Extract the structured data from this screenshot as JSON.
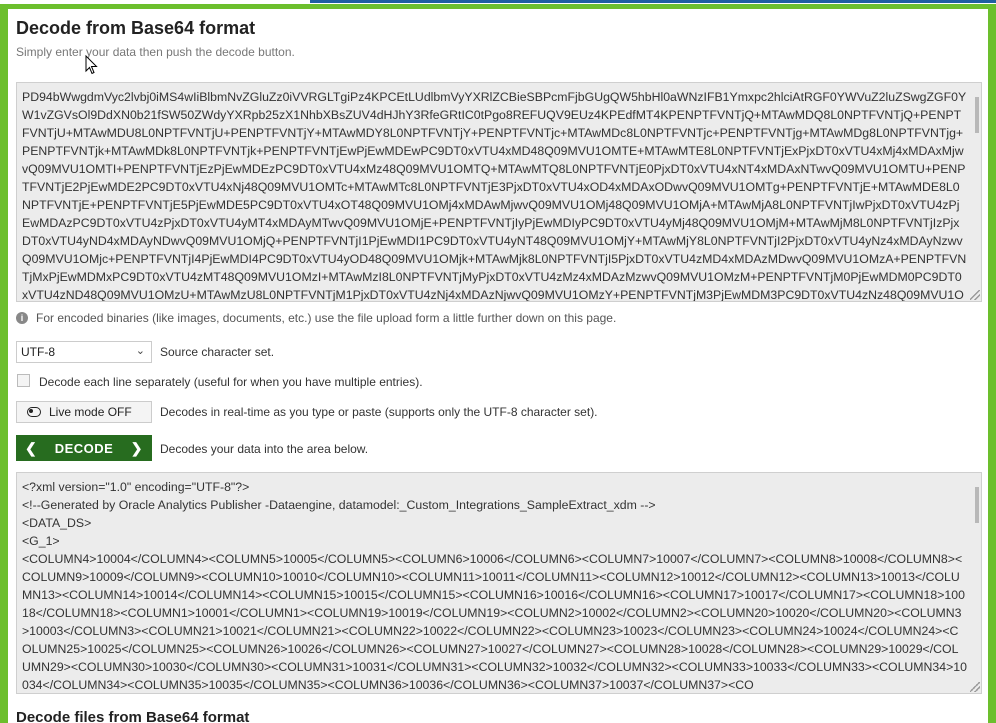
{
  "header": {
    "title": "Decode from Base64 format",
    "subtitle": "Simply enter your data then push the decode button."
  },
  "input_area": {
    "value": "PD94bWwgdmVyc2lvbj0iMS4wIiBlbmNvZGluZz0iVVRGLTgiPz4KPCEtLUdlbmVyYXRlZCBieSBPcmFjbGUgQW5hbHl0aWNzIFB1Ymxpc2hlciAtRGF0YWVuZ2luZSwgZGF0YW1vZGVsOl9DdXN0b21fSW50ZWdyYXRpb25zX1NhbXBsZUV4dHJhY3RfeGRtIC0tPgo8REFUQV9EUz4KPEdfMT4KPENPTFVNTjQ+MTAwMDQ8L0NPTFVNTjQ+PENPTFVNTjU+MTAwMDU8L0NPTFVNTjU+PENPTFVNTjY+MTAwMDY8L0NPTFVNTjY+PENPTFVNTjc+MTAwMDc8L0NPTFVNTjc+PENPTFVNTjg+MTAwMDg8L0NPTFVNTjg+PENPTFVNTjk+MTAwMDk8L0NPTFVNTjk+PENPTFVNTjEwPjEwMDEwPC9DT0xVTU4xMD48Q09MVU1OMTE+MTAwMTE8L0NPTFVNTjExPjxDT0xVTU4xMj4xMDAxMjwvQ09MVU1OMTI+PENPTFVNTjEzPjEwMDEzPC9DT0xVTU4xMz48Q09MVU1OMTQ+MTAwMTQ8L0NPTFVNTjE0PjxDT0xVTU4xNT4xMDAxNTwvQ09MVU1OMTU+PENPTFVNTjE2PjEwMDE2PC9DT0xVTU4xNj48Q09MVU1OMTc+MTAwMTc8L0NPTFVNTjE3PjxDT0xVTU4xOD4xMDAxODwvQ09MVU1OMTg+PENPTFVNTjE+MTAwMDE8L0NPTFVNTjE+PENPTFVNTjE5PjEwMDE5PC9DT0xVTU4xOT48Q09MVU1OMj4xMDAwMjwvQ09MVU1OMj48Q09MVU1OMjA+MTAwMjA8L0NPTFVNTjIwPjxDT0xVTU4zPjEwMDAzPC9DT0xVTU4zPjxDT0xVTU4yMT4xMDAyMTwvQ09MVU1OMjE+PENPTFVNTjIyPjEwMDIyPC9DT0xVTU4yMj48Q09MVU1OMjM+MTAwMjM8L0NPTFVNTjIzPjxDT0xVTU4yND4xMDAyNDwvQ09MVU1OMjQ+PENPTFVNTjI1PjEwMDI1PC9DT0xVTU4yNT48Q09MVU1OMjY+MTAwMjY8L0NPTFVNTjI2PjxDT0xVTU4yNz4xMDAyNzwvQ09MVU1OMjc+PENPTFVNTjI4PjEwMDI4PC9DT0xVTU4yOD48Q09MVU1OMjk+MTAwMjk8L0NPTFVNTjI5PjxDT0xVTU4zMD4xMDAzMDwvQ09MVU1OMzA+PENPTFVNTjMxPjEwMDMxPC9DT0xVTU4zMT48Q09MVU1OMzI+MTAwMzI8L0NPTFVNTjMyPjxDT0xVTU4zMz4xMDAzMzwvQ09MVU1OMzM+PENPTFVNTjM0PjEwMDM0PC9DT0xVTU4zND48Q09MVU1OMzU+MTAwMzU8L0NPTFVNTjM1PjxDT0xVTU4zNj4xMDAzNjwvQ09MVU1OMzY+PENPTFVNTjM3PjEwMDM3PC9DT0xVTU4zNz48Q09MVU1OMzg+"
  },
  "info_note": "For encoded binaries (like images, documents, etc.) use the file upload form a little further down on this page.",
  "source_charset": {
    "selected": "UTF-8",
    "label": "Source character set."
  },
  "decode_each_line": {
    "label": "Decode each line separately (useful for when you have multiple entries).",
    "checked": false
  },
  "live_mode": {
    "button_label": "Live mode OFF",
    "description": "Decodes in real-time as you type or paste (supports only the UTF-8 character set)."
  },
  "decode": {
    "button_label": "DECODE",
    "description": "Decodes your data into the area below."
  },
  "output_area": {
    "value": "<?xml version=\"1.0\" encoding=\"UTF-8\"?>\n<!--Generated by Oracle Analytics Publisher -Dataengine, datamodel:_Custom_Integrations_SampleExtract_xdm -->\n<DATA_DS>\n<G_1>\n<COLUMN4>10004</COLUMN4><COLUMN5>10005</COLUMN5><COLUMN6>10006</COLUMN6><COLUMN7>10007</COLUMN7><COLUMN8>10008</COLUMN8><COLUMN9>10009</COLUMN9><COLUMN10>10010</COLUMN10><COLUMN11>10011</COLUMN11><COLUMN12>10012</COLUMN12><COLUMN13>10013</COLUMN13><COLUMN14>10014</COLUMN14><COLUMN15>10015</COLUMN15><COLUMN16>10016</COLUMN16><COLUMN17>10017</COLUMN17><COLUMN18>10018</COLUMN18><COLUMN1>10001</COLUMN1><COLUMN19>10019</COLUMN19><COLUMN2>10002</COLUMN2><COLUMN20>10020</COLUMN20><COLUMN3>10003</COLUMN3><COLUMN21>10021</COLUMN21><COLUMN22>10022</COLUMN22><COLUMN23>10023</COLUMN23><COLUMN24>10024</COLUMN24><COLUMN25>10025</COLUMN25><COLUMN26>10026</COLUMN26><COLUMN27>10027</COLUMN27><COLUMN28>10028</COLUMN28><COLUMN29>10029</COLUMN29><COLUMN30>10030</COLUMN30><COLUMN31>10031</COLUMN31><COLUMN32>10032</COLUMN32><COLUMN33>10033</COLUMN33><COLUMN34>10034</COLUMN34><COLUMN35>10035</COLUMN35><COLUMN36>10036</COLUMN36><COLUMN37>10037</COLUMN37><CO"
  },
  "next_section_title": "Decode files from Base64 format"
}
